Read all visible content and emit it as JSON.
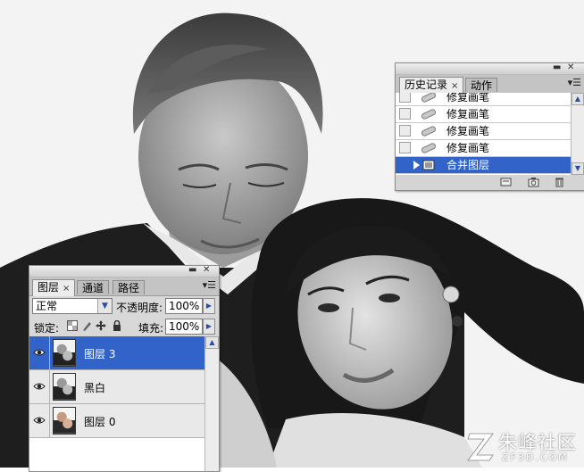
{
  "history_panel": {
    "tabs": [
      {
        "label": "历史记录",
        "close": "×"
      },
      {
        "label": "动作"
      }
    ],
    "menu_icon": "panel-menu-icon",
    "items": [
      {
        "label": "修复画笔",
        "icon": "healing-brush-icon"
      },
      {
        "label": "修复画笔",
        "icon": "healing-brush-icon"
      },
      {
        "label": "修复画笔",
        "icon": "healing-brush-icon"
      },
      {
        "label": "修复画笔",
        "icon": "healing-brush-icon"
      },
      {
        "label": "合并图层",
        "icon": "merge-layers-icon",
        "selected": true
      }
    ]
  },
  "layers_panel": {
    "tabs": [
      {
        "label": "图层",
        "close": "×"
      },
      {
        "label": "通道"
      },
      {
        "label": "路径"
      }
    ],
    "blend_mode": "正常",
    "opacity_label": "不透明度:",
    "opacity_value": "100%",
    "lock_label": "锁定:",
    "fill_label": "填充:",
    "fill_value": "100%",
    "layers": [
      {
        "name": "图层 3",
        "selected": true,
        "visible": true
      },
      {
        "name": "黑白",
        "selected": false,
        "visible": true
      },
      {
        "name": "图层 0",
        "selected": false,
        "visible": true
      }
    ]
  },
  "watermark": {
    "brand": "朱峰社区",
    "domain": "ZF3D.COM"
  },
  "colors": {
    "selection": "#3163c8",
    "panel": "#d8d8d8"
  }
}
